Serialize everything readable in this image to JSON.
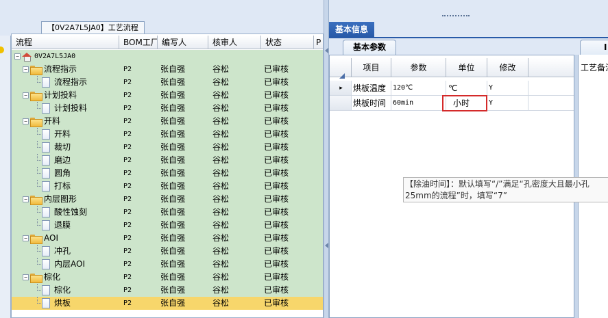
{
  "left": {
    "tab_title": "【0V2A7L5JA0】工艺流程",
    "columns": [
      "流程",
      "BOM工厂",
      "编写人",
      "核审人",
      "状态",
      "P"
    ],
    "root": "0V2A7L5JA0",
    "rows": [
      {
        "name": "流程指示",
        "type": "folder",
        "level": 1,
        "bom": "P2",
        "writer": "张自强",
        "reviewer": "谷松",
        "status": "已审核"
      },
      {
        "name": "流程指示",
        "type": "doc",
        "level": 2,
        "bom": "P2",
        "writer": "张自强",
        "reviewer": "谷松",
        "status": "已审核"
      },
      {
        "name": "计划投料",
        "type": "folder",
        "level": 1,
        "bom": "P2",
        "writer": "张自强",
        "reviewer": "谷松",
        "status": "已审核"
      },
      {
        "name": "计划投料",
        "type": "doc",
        "level": 2,
        "bom": "P2",
        "writer": "张自强",
        "reviewer": "谷松",
        "status": "已审核"
      },
      {
        "name": "开料",
        "type": "folder",
        "level": 1,
        "bom": "P2",
        "writer": "张自强",
        "reviewer": "谷松",
        "status": "已审核"
      },
      {
        "name": "开料",
        "type": "doc",
        "level": 2,
        "bom": "P2",
        "writer": "张自强",
        "reviewer": "谷松",
        "status": "已审核"
      },
      {
        "name": "裁切",
        "type": "doc",
        "level": 2,
        "bom": "P2",
        "writer": "张自强",
        "reviewer": "谷松",
        "status": "已审核"
      },
      {
        "name": "磨边",
        "type": "doc",
        "level": 2,
        "bom": "P2",
        "writer": "张自强",
        "reviewer": "谷松",
        "status": "已审核"
      },
      {
        "name": "圆角",
        "type": "doc",
        "level": 2,
        "bom": "P2",
        "writer": "张自强",
        "reviewer": "谷松",
        "status": "已审核"
      },
      {
        "name": "打标",
        "type": "doc",
        "level": 2,
        "bom": "P2",
        "writer": "张自强",
        "reviewer": "谷松",
        "status": "已审核"
      },
      {
        "name": "内层图形",
        "type": "folder",
        "level": 1,
        "bom": "P2",
        "writer": "张自强",
        "reviewer": "谷松",
        "status": "已审核"
      },
      {
        "name": "酸性蚀刻",
        "type": "doc",
        "level": 2,
        "bom": "P2",
        "writer": "张自强",
        "reviewer": "谷松",
        "status": "已审核"
      },
      {
        "name": "退膜",
        "type": "doc",
        "level": 2,
        "bom": "P2",
        "writer": "张自强",
        "reviewer": "谷松",
        "status": "已审核"
      },
      {
        "name": "AOI",
        "type": "folder",
        "level": 1,
        "bom": "P2",
        "writer": "张自强",
        "reviewer": "谷松",
        "status": "已审核"
      },
      {
        "name": "冲孔",
        "type": "doc",
        "level": 2,
        "bom": "P2",
        "writer": "张自强",
        "reviewer": "谷松",
        "status": "已审核"
      },
      {
        "name": "内层AOI",
        "type": "doc",
        "level": 2,
        "bom": "P2",
        "writer": "张自强",
        "reviewer": "谷松",
        "status": "已审核"
      },
      {
        "name": "棕化",
        "type": "folder",
        "level": 1,
        "bom": "P2",
        "writer": "张自强",
        "reviewer": "谷松",
        "status": "已审核"
      },
      {
        "name": "棕化",
        "type": "doc",
        "level": 2,
        "bom": "P2",
        "writer": "张自强",
        "reviewer": "谷松",
        "status": "已审核"
      },
      {
        "name": "烘板",
        "type": "doc",
        "level": 2,
        "bom": "P2",
        "writer": "张自强",
        "reviewer": "谷松",
        "status": "已审核",
        "selected": true
      }
    ]
  },
  "right": {
    "info_tab": "基本信息",
    "inner_tab": "基本参数",
    "sub_tab": "I",
    "sub_label": "工艺备注",
    "param_columns": [
      "项目",
      "参数",
      "单位",
      "修改"
    ],
    "params": [
      {
        "item": "烘板温度",
        "value": "120℃",
        "unit": "℃",
        "modify": "Y",
        "current": true
      },
      {
        "item": "烘板时间",
        "value": "60min",
        "unit": "小时",
        "modify": "Y",
        "current": false
      }
    ],
    "tooltip_line1": "【除油时间】：默认填写“/”满足“孔密度大且最小孔",
    "tooltip_line2": "25mm的流程”时，填写“7”"
  },
  "colors": {
    "row_bg": "#cde5cb",
    "selected_row": "#f7d66b",
    "tab_blue": "#285aa8",
    "highlight_red": "#d42a2a"
  }
}
